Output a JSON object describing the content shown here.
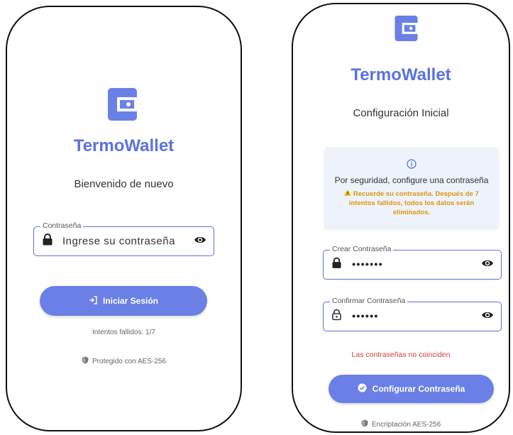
{
  "colors": {
    "accent": "#5b72df",
    "button": "#6a80e6",
    "warning": "#e0950e",
    "error": "#d83a3a",
    "info_bg": "#eef3fb"
  },
  "login": {
    "app_title": "TermoWallet",
    "welcome": "Bienvenido de nuevo",
    "password_label": "Contraseña",
    "password_placeholder": "Ingrese su contraseña",
    "login_button": "Iniciar Sesión",
    "failed_attempts": "Intentos fallidos: 1/7",
    "security_note": "Protegido con AES-256"
  },
  "setup": {
    "app_title": "TermoWallet",
    "subtitle": "Configuración Inicial",
    "info_main": "Por seguridad, configure una contraseña",
    "info_warning": "Recuerde su contraseña. Después de 7 intentos fallidos, todos los datos serán eliminados.",
    "create_label": "Crear Contraseña",
    "create_value": "•••••••",
    "confirm_label": "Confirmar Contraseña",
    "confirm_value": "••••••",
    "error": "Las contraseñas no coinciden",
    "configure_button": "Configurar Contraseña",
    "encryption_note": "Encriptación AES-256"
  },
  "icons": [
    "wallet-icon",
    "lock-icon",
    "eye-icon",
    "login-icon",
    "shield-icon",
    "info-icon",
    "warning-icon",
    "lock-open-icon",
    "check-circle-icon"
  ]
}
